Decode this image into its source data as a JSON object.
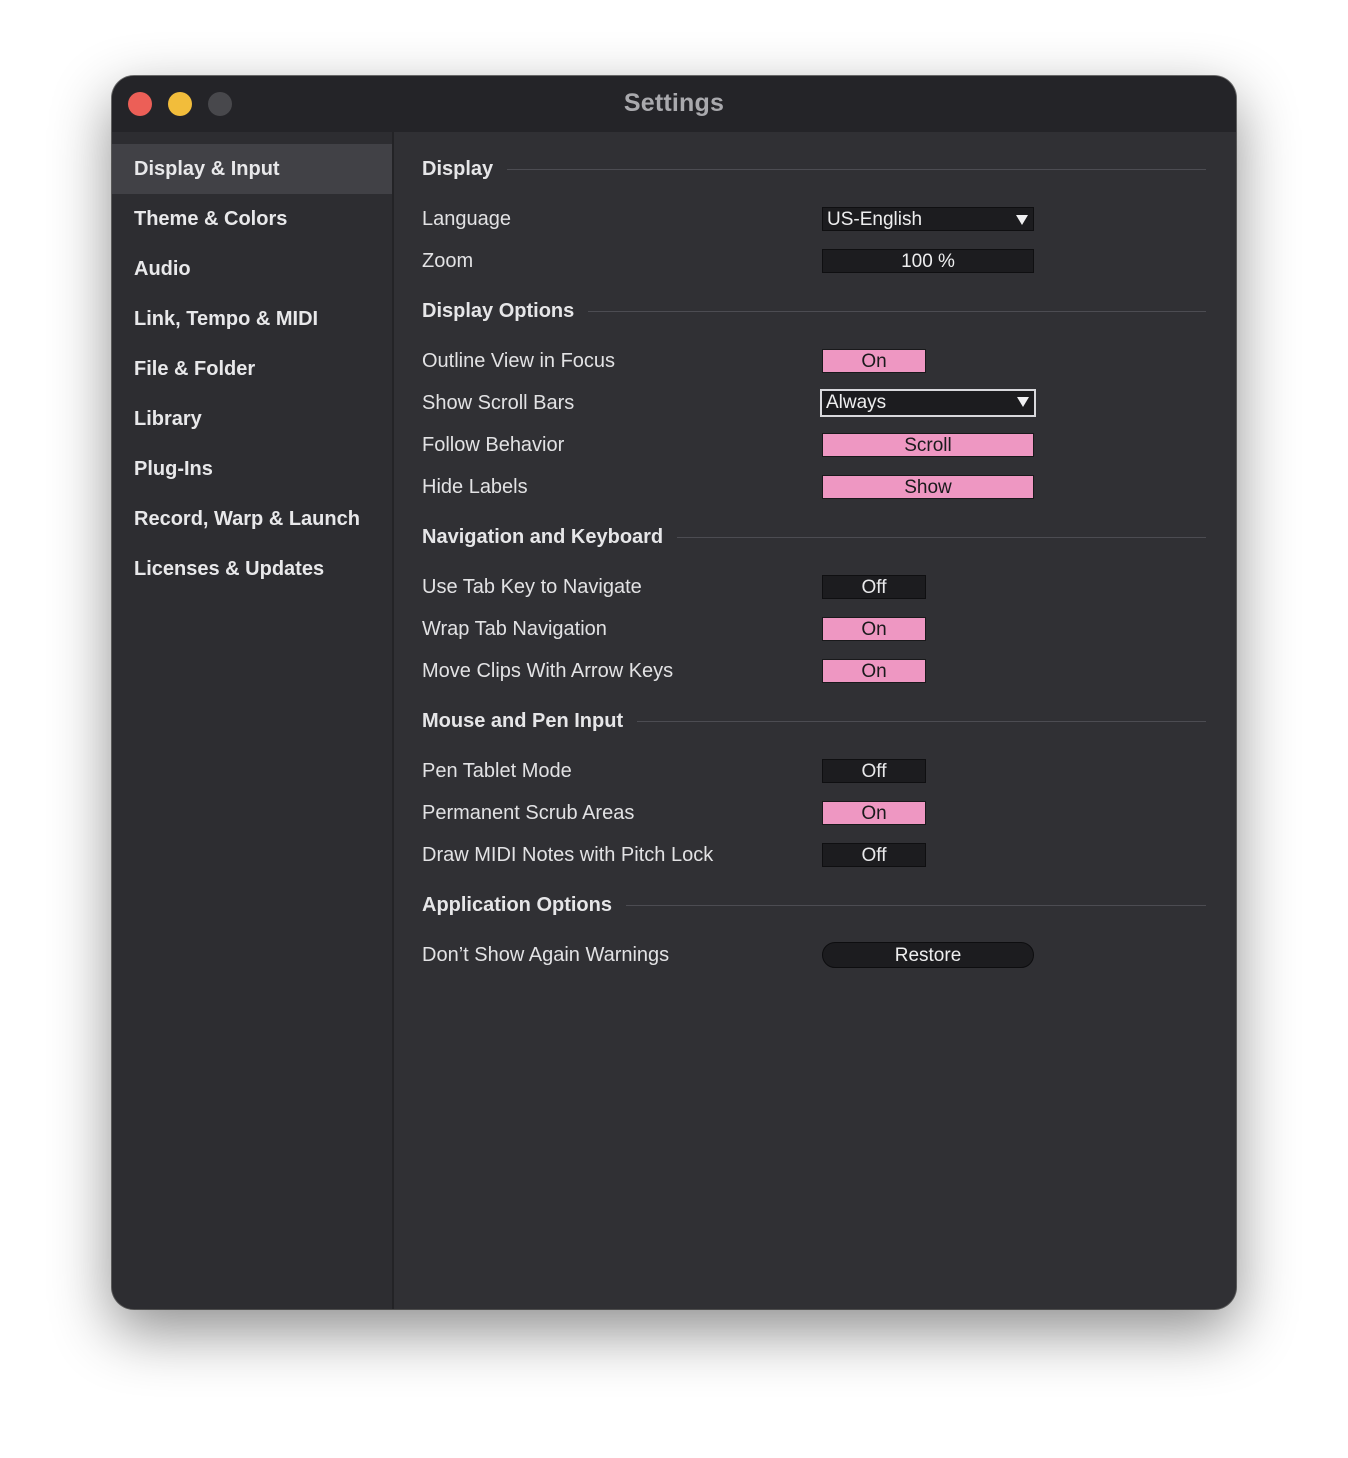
{
  "window": {
    "title": "Settings"
  },
  "sidebar": {
    "items": [
      {
        "label": "Display & Input",
        "active": true
      },
      {
        "label": "Theme & Colors"
      },
      {
        "label": "Audio"
      },
      {
        "label": "Link, Tempo & MIDI"
      },
      {
        "label": "File & Folder"
      },
      {
        "label": "Library"
      },
      {
        "label": "Plug-Ins"
      },
      {
        "label": "Record, Warp & Launch"
      },
      {
        "label": "Licenses & Updates"
      }
    ]
  },
  "sections": {
    "display": {
      "title": "Display",
      "language": {
        "label": "Language",
        "value": "US-English"
      },
      "zoom": {
        "label": "Zoom",
        "value": "100 %"
      }
    },
    "display_options": {
      "title": "Display Options",
      "outline_view": {
        "label": "Outline View in Focus",
        "value": "On"
      },
      "scroll_bars": {
        "label": "Show Scroll Bars",
        "value": "Always"
      },
      "follow_behavior": {
        "label": "Follow Behavior",
        "value": "Scroll"
      },
      "hide_labels": {
        "label": "Hide Labels",
        "value": "Show"
      }
    },
    "navigation": {
      "title": "Navigation and Keyboard",
      "tab_key": {
        "label": "Use Tab Key to Navigate",
        "value": "Off"
      },
      "wrap_tab": {
        "label": "Wrap Tab Navigation",
        "value": "On"
      },
      "move_clips": {
        "label": "Move Clips With Arrow Keys",
        "value": "On"
      }
    },
    "mouse_pen": {
      "title": "Mouse and Pen Input",
      "pen_tablet": {
        "label": "Pen Tablet Mode",
        "value": "Off"
      },
      "scrub_areas": {
        "label": "Permanent Scrub Areas",
        "value": "On"
      },
      "pitch_lock": {
        "label": "Draw MIDI Notes with Pitch Lock",
        "value": "Off"
      }
    },
    "application": {
      "title": "Application Options",
      "warnings": {
        "label": "Don’t Show Again Warnings",
        "button": "Restore"
      }
    }
  },
  "colors": {
    "accent_on": "#ee97c2",
    "toggle_off": "#1c1c1f",
    "window_bg": "#303034",
    "sidebar_active": "#414146"
  }
}
